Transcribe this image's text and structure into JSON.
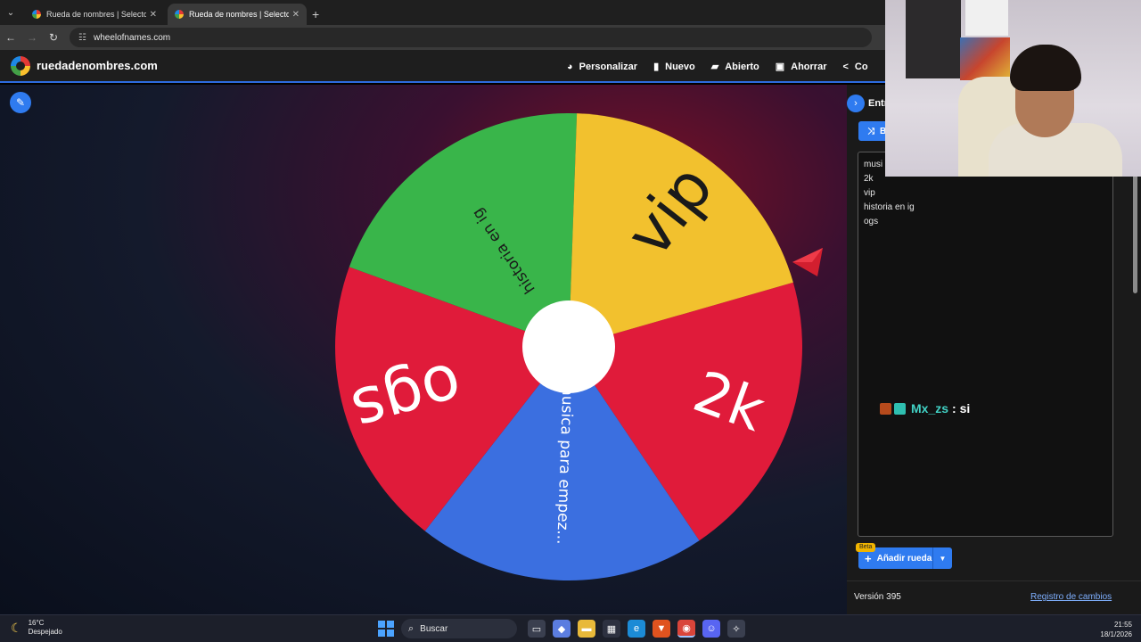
{
  "browser": {
    "tabs": [
      {
        "title": "Rueda de nombres | Selector de"
      },
      {
        "title": "Rueda de nombres | Selector de"
      }
    ],
    "url": "wheelofnames.com"
  },
  "app": {
    "brand": "ruedadenombres.com",
    "menu": [
      "Personalizar",
      "Nuevo",
      "Abierto",
      "Ahorrar",
      "Co"
    ]
  },
  "wheel": {
    "segments": [
      {
        "label": "2k",
        "color": "#e01b3a"
      },
      {
        "label": "musica para empez...",
        "color": "#3b6fe0"
      },
      {
        "label": "ogs",
        "color": "#e01b3a"
      },
      {
        "label": "historia en ig",
        "color": "#39b54a"
      },
      {
        "label": "vip",
        "color": "#f2c12e"
      }
    ]
  },
  "panel": {
    "tab_label": "Entrad",
    "shuffle_label": "B",
    "entries": [
      "musi",
      "2k",
      "vip",
      "historia en ig",
      "ogs"
    ],
    "add_wheel": "Añadir rueda",
    "beta": "Beta",
    "version": "Versión 395",
    "changelog": "Registro de cambios"
  },
  "chat": {
    "user": "Mx_zs",
    "message": ": si"
  },
  "taskbar": {
    "temp": "16°C",
    "condition": "Despejado",
    "search": "Buscar",
    "time": "21:55",
    "date": "18/1/2026"
  }
}
